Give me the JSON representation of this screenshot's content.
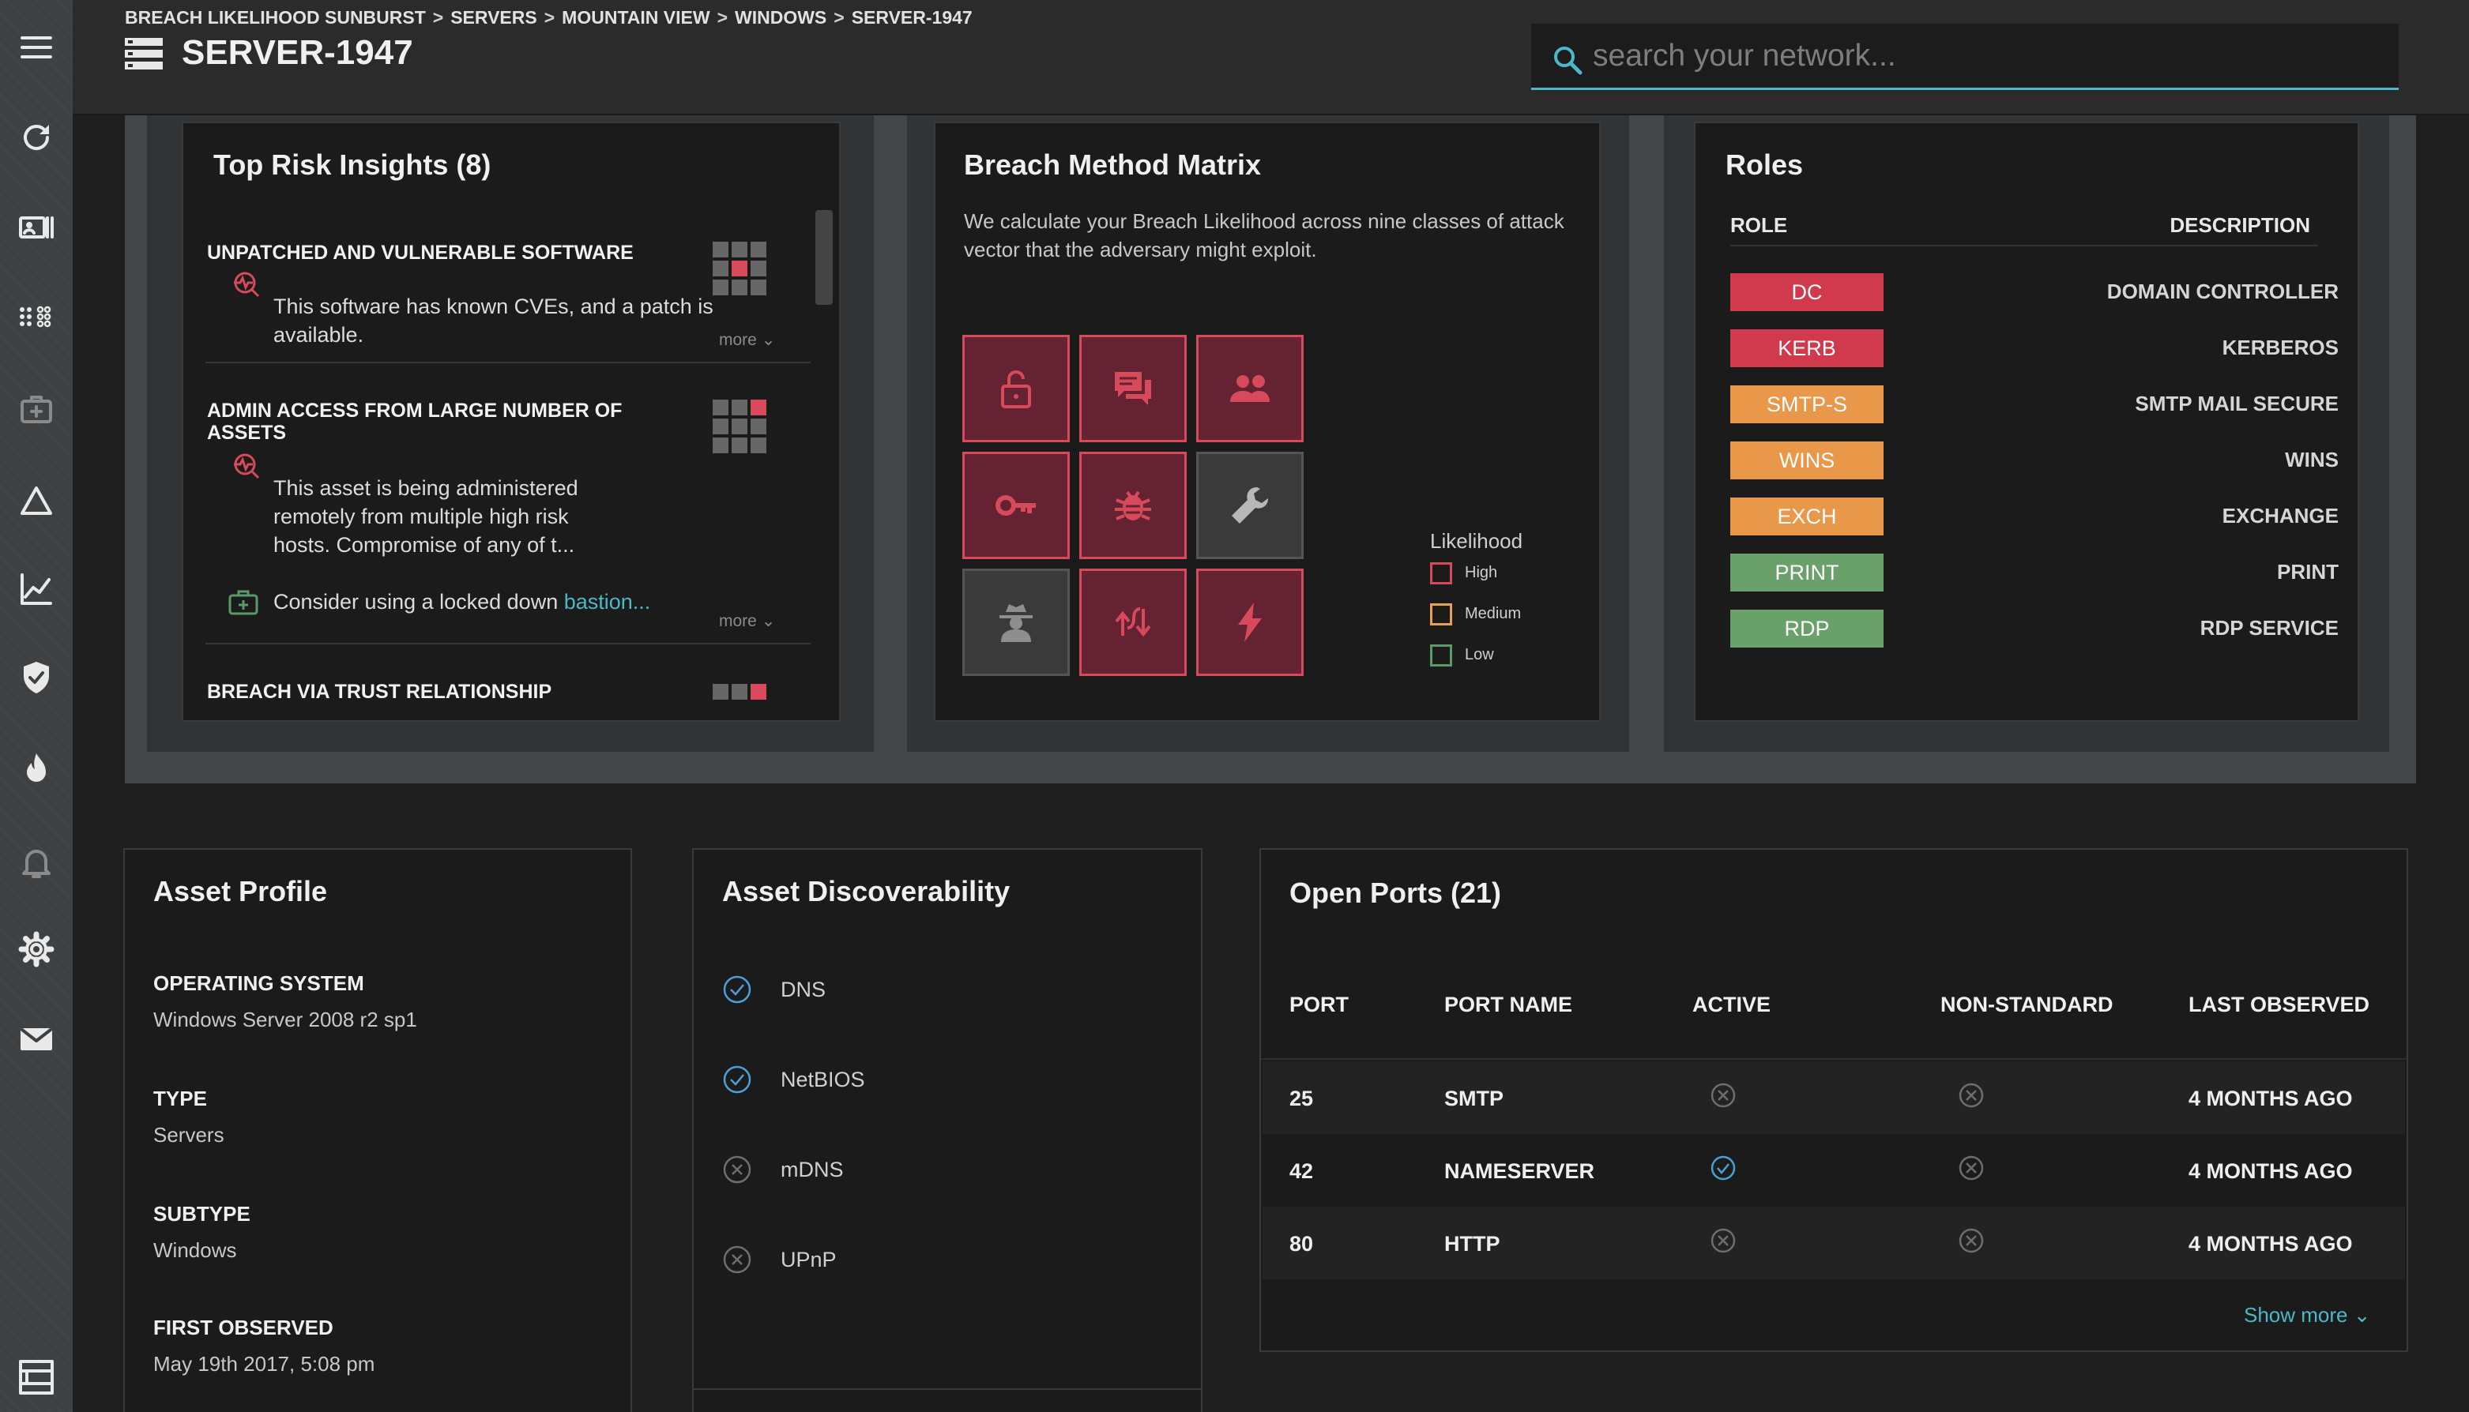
{
  "header": {
    "breadcrumb": [
      "BREACH LIKELIHOOD SUNBURST",
      "SERVERS",
      "MOUNTAIN VIEW",
      "WINDOWS",
      "SERVER-1947"
    ],
    "breadcrumb_separator": ">",
    "title": "SERVER-1947",
    "search_placeholder": "search your network..."
  },
  "sidebar": {
    "icons": [
      "menu-icon",
      "refresh-icon",
      "contact-card-icon",
      "dots-grid-icon",
      "medkit-icon",
      "triangle-icon",
      "trend-chart-icon",
      "shield-check-icon",
      "flame-icon",
      "bell-icon",
      "gear-icon",
      "mail-icon",
      "layout-icon"
    ]
  },
  "insights": {
    "title": "Top Risk Insights (8)",
    "items": [
      {
        "title": "UNPATCHED AND VULNERABLE SOFTWARE",
        "desc_lines": [
          "This software has known CVEs, and a patch is",
          "available."
        ],
        "more": "more"
      },
      {
        "title_lines": [
          "ADMIN ACCESS FROM LARGE NUMBER OF",
          "ASSETS"
        ],
        "desc_lines": [
          "This asset is being administered",
          "remotely from multiple high risk",
          "hosts. Compromise of any of t..."
        ],
        "recommendation_prefix": "Consider using a locked down ",
        "recommendation_link": "bastion...",
        "more": "more"
      },
      {
        "title": "BREACH VIA TRUST RELATIONSHIP"
      }
    ]
  },
  "matrix": {
    "title": "Breach Method Matrix",
    "desc_lines": [
      "We calculate your Breach Likelihood across nine classes of attack",
      "vector that the adversary might exploit."
    ],
    "cells": [
      {
        "icon": "unlock-icon",
        "level": "high"
      },
      {
        "icon": "chat-icon",
        "level": "high"
      },
      {
        "icon": "users-icon",
        "level": "high"
      },
      {
        "icon": "key-icon",
        "level": "high"
      },
      {
        "icon": "bug-icon",
        "level": "high"
      },
      {
        "icon": "wrench-icon",
        "level": "none"
      },
      {
        "icon": "spy-icon",
        "level": "none"
      },
      {
        "icon": "transfer-icon",
        "level": "high"
      },
      {
        "icon": "lightning-icon",
        "level": "high"
      }
    ],
    "legend": {
      "title": "Likelihood",
      "high": "High",
      "medium": "Medium",
      "low": "Low"
    },
    "colors": {
      "high": "#d64a5b",
      "medium": "#e8a052",
      "low": "#5a9a6a"
    }
  },
  "roles": {
    "title": "Roles",
    "col_role": "ROLE",
    "col_desc": "DESCRIPTION",
    "items": [
      {
        "badge": "DC",
        "desc": "DOMAIN CONTROLLER",
        "color": "#d13a4c"
      },
      {
        "badge": "KERB",
        "desc": "KERBEROS",
        "color": "#d13a4c"
      },
      {
        "badge": "SMTP-S",
        "desc": "SMTP MAIL SECURE",
        "color": "#e89848"
      },
      {
        "badge": "WINS",
        "desc": "WINS",
        "color": "#e89848"
      },
      {
        "badge": "EXCH",
        "desc": "EXCHANGE",
        "color": "#e89848"
      },
      {
        "badge": "PRINT",
        "desc": "PRINT",
        "color": "#6aa06a"
      },
      {
        "badge": "RDP",
        "desc": "RDP SERVICE",
        "color": "#6aa06a"
      }
    ]
  },
  "profile": {
    "title": "Asset Profile",
    "fields": [
      {
        "label": "OPERATING SYSTEM",
        "value": "Windows Server 2008 r2 sp1"
      },
      {
        "label": "TYPE",
        "value": "Servers"
      },
      {
        "label": "SUBTYPE",
        "value": "Windows"
      },
      {
        "label": "FIRST OBSERVED",
        "value": "May 19th 2017, 5:08 pm"
      }
    ]
  },
  "discoverability": {
    "title": "Asset Discoverability",
    "items": [
      {
        "label": "DNS",
        "enabled": true
      },
      {
        "label": "NetBIOS",
        "enabled": true
      },
      {
        "label": "mDNS",
        "enabled": false
      },
      {
        "label": "UPnP",
        "enabled": false
      }
    ]
  },
  "ports": {
    "title": "Open Ports (21)",
    "headers": {
      "port": "PORT",
      "name": "PORT NAME",
      "active": "ACTIVE",
      "nonstandard": "NON-STANDARD",
      "observed": "LAST OBSERVED"
    },
    "rows": [
      {
        "port": "25",
        "name": "SMTP",
        "active": false,
        "nonstandard": false,
        "observed": "4 MONTHS AGO"
      },
      {
        "port": "42",
        "name": "NAMESERVER",
        "active": true,
        "nonstandard": false,
        "observed": "4 MONTHS AGO"
      },
      {
        "port": "80",
        "name": "HTTP",
        "active": false,
        "nonstandard": false,
        "observed": "4 MONTHS AGO"
      }
    ],
    "show_more": "Show more"
  }
}
